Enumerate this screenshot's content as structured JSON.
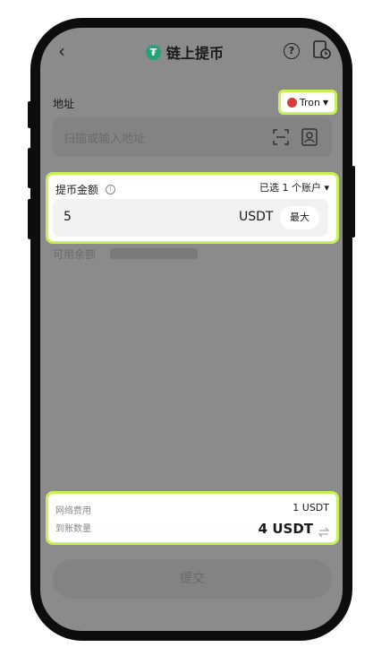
{
  "header": {
    "title": "链上提币",
    "back_glyph": "‹"
  },
  "address": {
    "label": "地址",
    "chain": "Tron",
    "placeholder": "扫描或输入地址"
  },
  "amount": {
    "label": "提币金额",
    "info_glyph": "i",
    "account_selector": "已选 1 个账户 ▾",
    "value": "5",
    "unit": "USDT",
    "max_label": "最大"
  },
  "available": {
    "label": "可用余额"
  },
  "fees": {
    "network_fee_label": "网络费用",
    "network_fee_value": "1 USDT",
    "received_label": "到账数量",
    "received_value": "4 USDT"
  },
  "submit": {
    "label": "提交"
  },
  "colors": {
    "highlight": "#c7f154",
    "tether": "#26a17b",
    "tron": "#d93a3a"
  }
}
